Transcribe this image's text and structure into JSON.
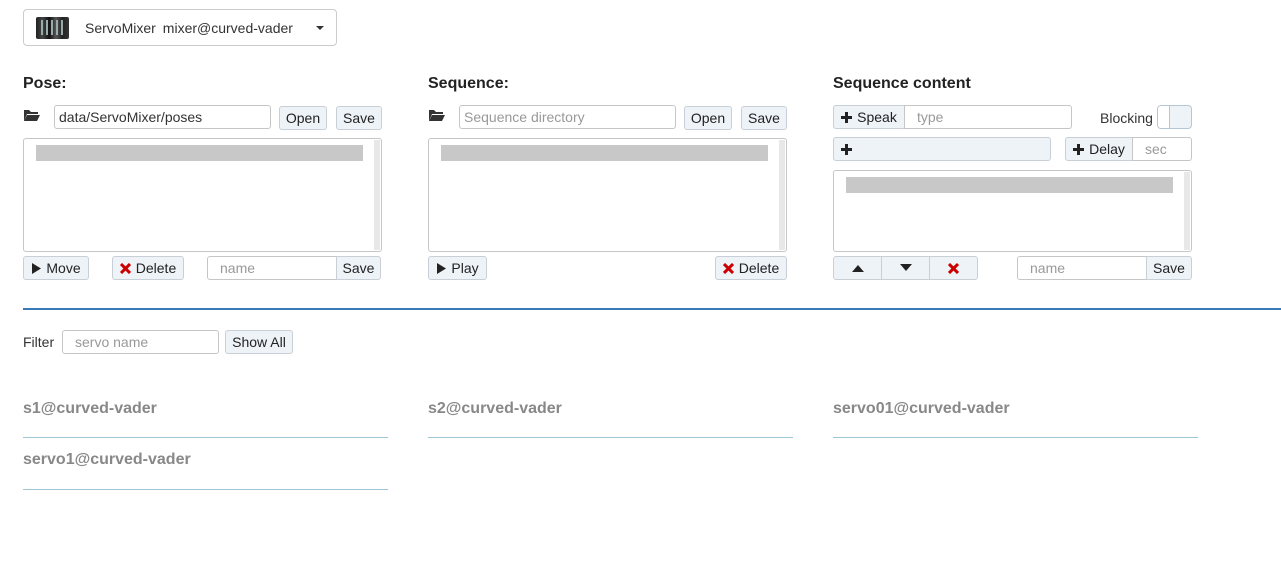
{
  "service": {
    "name": "ServoMixer",
    "instance": "mixer@curved-vader"
  },
  "pose": {
    "title": "Pose:",
    "directory_value": "data/ServoMixer/poses",
    "open_label": "Open",
    "save_label": "Save",
    "move_label": "Move",
    "delete_label": "Delete",
    "name_placeholder": "name",
    "name_save_label": "Save"
  },
  "sequence": {
    "title": "Sequence:",
    "directory_placeholder": "Sequence directory",
    "open_label": "Open",
    "save_label": "Save",
    "play_label": "Play",
    "delete_label": "Delete"
  },
  "sequence_content": {
    "title": "Sequence content",
    "speak_label": "Speak",
    "speak_placeholder": "type",
    "blocking_label": "Blocking",
    "delay_label": "Delay",
    "delay_placeholder": "sec",
    "name_placeholder": "name",
    "save_label": "Save"
  },
  "filter": {
    "label": "Filter",
    "placeholder": "servo name",
    "show_all_label": "Show All"
  },
  "servos": [
    "s1@curved-vader",
    "s2@curved-vader",
    "servo01@curved-vader",
    "servo1@curved-vader"
  ],
  "colors": {
    "delete_icon": "#cc0000",
    "divider": "#3a7ab8",
    "servo_line": "#9cc7d3"
  }
}
